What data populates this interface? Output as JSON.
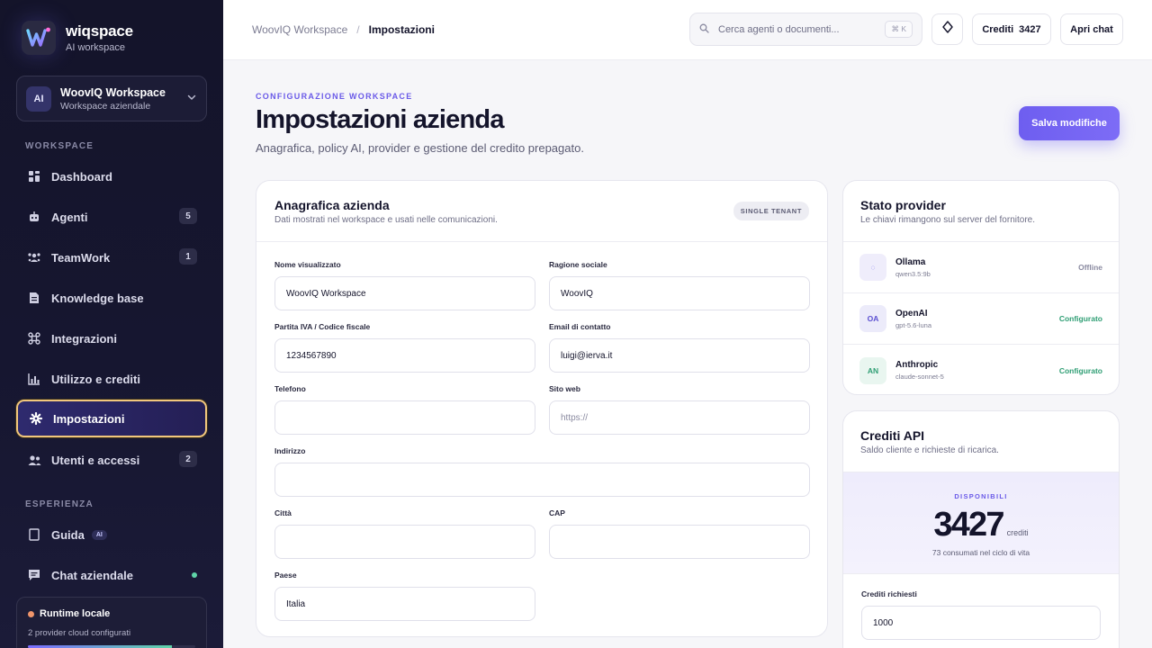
{
  "brand": {
    "name": "wiqspace",
    "sub": "AI workspace"
  },
  "workspace_switcher": {
    "initials": "AI",
    "name": "WoovIQ Workspace",
    "type": "Workspace aziendale"
  },
  "sidebar": {
    "section_workspace": "WORKSPACE",
    "section_experience": "ESPERIENZA",
    "items": [
      {
        "label": "Dashboard",
        "icon": "dashboard-icon",
        "badge": ""
      },
      {
        "label": "Agenti",
        "icon": "robot-icon",
        "badge": "5"
      },
      {
        "label": "TeamWork",
        "icon": "team-icon",
        "badge": "1"
      },
      {
        "label": "Knowledge base",
        "icon": "document-icon",
        "badge": ""
      },
      {
        "label": "Integrazioni",
        "icon": "integrations-icon",
        "badge": ""
      },
      {
        "label": "Utilizzo e crediti",
        "icon": "bar-chart-icon",
        "badge": ""
      },
      {
        "label": "Impostazioni",
        "icon": "gear-icon",
        "badge": "",
        "active": true
      },
      {
        "label": "Utenti e accessi",
        "icon": "users-icon",
        "badge": "2"
      }
    ],
    "experience_items": [
      {
        "label": "Guida",
        "icon": "book-icon",
        "pill": "AI"
      },
      {
        "label": "Chat aziendale",
        "icon": "chat-icon",
        "status": "online"
      }
    ],
    "runtime": {
      "title": "Runtime locale",
      "sub": "2 provider cloud configurati",
      "progress": 0.86
    }
  },
  "topbar": {
    "breadcrumb": [
      "WoovIQ Workspace",
      "Impostazioni"
    ],
    "breadcrumb_sep": "/",
    "search_placeholder": "Cerca agenti o documenti...",
    "search_shortcut": "⌘ K",
    "credits_label": "Crediti",
    "credits_value": "3427",
    "open_chat": "Apri chat"
  },
  "header": {
    "eyebrow": "CONFIGURAZIONE WORKSPACE",
    "title": "Impostazioni azienda",
    "subtitle": "Anagrafica, policy AI, provider e gestione del credito prepagato.",
    "save_label": "Salva modifiche"
  },
  "company": {
    "title": "Anagrafica azienda",
    "subtitle": "Dati mostrati nel workspace e usati nelle comunicazioni.",
    "tenant_pill": "SINGLE TENANT",
    "fields": {
      "display_name": {
        "label": "Nome visualizzato",
        "value": "WoovIQ Workspace"
      },
      "legal_name": {
        "label": "Ragione sociale",
        "value": "WoovIQ"
      },
      "vat": {
        "label": "Partita IVA / Codice fiscale",
        "value": "1234567890"
      },
      "email": {
        "label": "Email di contatto",
        "value": "luigi@ierva.it"
      },
      "phone": {
        "label": "Telefono",
        "value": ""
      },
      "website": {
        "label": "Sito web",
        "value": "",
        "placeholder": "https://"
      },
      "address": {
        "label": "Indirizzo",
        "value": ""
      },
      "city": {
        "label": "Città",
        "value": ""
      },
      "zip": {
        "label": "CAP",
        "value": ""
      },
      "country": {
        "label": "Paese",
        "value": "Italia"
      }
    }
  },
  "providers": {
    "title": "Stato provider",
    "subtitle": "Le chiavi rimangono sul server del fornitore.",
    "items": [
      {
        "name": "Ollama",
        "model": "qwen3.5:9b",
        "initials": "◌",
        "status": "Offline",
        "status_color": "#8a8aa0",
        "icon_bg": "#efedfb",
        "icon_fg": "#7a6cf0"
      },
      {
        "name": "OpenAI",
        "model": "gpt-5.6-luna",
        "initials": "OA",
        "status": "Configurato",
        "status_color": "#2f9e74",
        "icon_bg": "#ecebfa",
        "icon_fg": "#5b4fd1"
      },
      {
        "name": "Anthropic",
        "model": "claude-sonnet-5",
        "initials": "AN",
        "status": "Configurato",
        "status_color": "#2f9e74",
        "icon_bg": "#e9f6f0",
        "icon_fg": "#2f9e74"
      }
    ]
  },
  "credits": {
    "title": "Crediti API",
    "subtitle": "Saldo cliente e richieste di ricarica.",
    "eyebrow": "DISPONIBILI",
    "value": "3427",
    "unit": "crediti",
    "note": "73 consumati nel ciclo di vita",
    "request_label": "Crediti richiesti",
    "request_value": "1000"
  },
  "colors": {
    "accent": "#6e5ef0",
    "sidebar_bg": "#14142a",
    "active_border": "#f1c77d",
    "success": "#2f9e74"
  }
}
